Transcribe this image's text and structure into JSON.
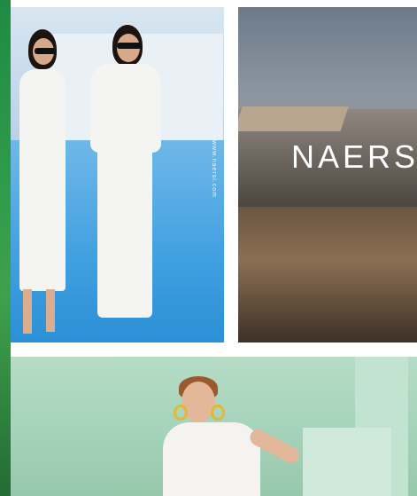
{
  "gallery": {
    "tiles": [
      {
        "id": "tile-white-outfits",
        "vertical_caption": "www.naersi.com"
      },
      {
        "id": "tile-architecture",
        "brand_text": "NAERS"
      },
      {
        "id": "tile-green-studio"
      }
    ]
  },
  "colors": {
    "strip": "#2e9a4c",
    "pool": "#3f9fe0",
    "studio": "#a6d3bb"
  }
}
